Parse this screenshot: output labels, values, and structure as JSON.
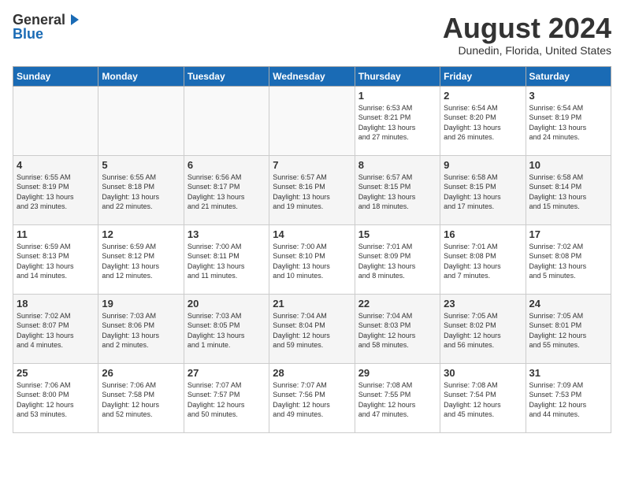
{
  "header": {
    "logo_general": "General",
    "logo_blue": "Blue",
    "title": "August 2024",
    "subtitle": "Dunedin, Florida, United States"
  },
  "weekdays": [
    "Sunday",
    "Monday",
    "Tuesday",
    "Wednesday",
    "Thursday",
    "Friday",
    "Saturday"
  ],
  "weeks": [
    [
      {
        "day": "",
        "info": ""
      },
      {
        "day": "",
        "info": ""
      },
      {
        "day": "",
        "info": ""
      },
      {
        "day": "",
        "info": ""
      },
      {
        "day": "1",
        "info": "Sunrise: 6:53 AM\nSunset: 8:21 PM\nDaylight: 13 hours\nand 27 minutes."
      },
      {
        "day": "2",
        "info": "Sunrise: 6:54 AM\nSunset: 8:20 PM\nDaylight: 13 hours\nand 26 minutes."
      },
      {
        "day": "3",
        "info": "Sunrise: 6:54 AM\nSunset: 8:19 PM\nDaylight: 13 hours\nand 24 minutes."
      }
    ],
    [
      {
        "day": "4",
        "info": "Sunrise: 6:55 AM\nSunset: 8:19 PM\nDaylight: 13 hours\nand 23 minutes."
      },
      {
        "day": "5",
        "info": "Sunrise: 6:55 AM\nSunset: 8:18 PM\nDaylight: 13 hours\nand 22 minutes."
      },
      {
        "day": "6",
        "info": "Sunrise: 6:56 AM\nSunset: 8:17 PM\nDaylight: 13 hours\nand 21 minutes."
      },
      {
        "day": "7",
        "info": "Sunrise: 6:57 AM\nSunset: 8:16 PM\nDaylight: 13 hours\nand 19 minutes."
      },
      {
        "day": "8",
        "info": "Sunrise: 6:57 AM\nSunset: 8:15 PM\nDaylight: 13 hours\nand 18 minutes."
      },
      {
        "day": "9",
        "info": "Sunrise: 6:58 AM\nSunset: 8:15 PM\nDaylight: 13 hours\nand 17 minutes."
      },
      {
        "day": "10",
        "info": "Sunrise: 6:58 AM\nSunset: 8:14 PM\nDaylight: 13 hours\nand 15 minutes."
      }
    ],
    [
      {
        "day": "11",
        "info": "Sunrise: 6:59 AM\nSunset: 8:13 PM\nDaylight: 13 hours\nand 14 minutes."
      },
      {
        "day": "12",
        "info": "Sunrise: 6:59 AM\nSunset: 8:12 PM\nDaylight: 13 hours\nand 12 minutes."
      },
      {
        "day": "13",
        "info": "Sunrise: 7:00 AM\nSunset: 8:11 PM\nDaylight: 13 hours\nand 11 minutes."
      },
      {
        "day": "14",
        "info": "Sunrise: 7:00 AM\nSunset: 8:10 PM\nDaylight: 13 hours\nand 10 minutes."
      },
      {
        "day": "15",
        "info": "Sunrise: 7:01 AM\nSunset: 8:09 PM\nDaylight: 13 hours\nand 8 minutes."
      },
      {
        "day": "16",
        "info": "Sunrise: 7:01 AM\nSunset: 8:08 PM\nDaylight: 13 hours\nand 7 minutes."
      },
      {
        "day": "17",
        "info": "Sunrise: 7:02 AM\nSunset: 8:08 PM\nDaylight: 13 hours\nand 5 minutes."
      }
    ],
    [
      {
        "day": "18",
        "info": "Sunrise: 7:02 AM\nSunset: 8:07 PM\nDaylight: 13 hours\nand 4 minutes."
      },
      {
        "day": "19",
        "info": "Sunrise: 7:03 AM\nSunset: 8:06 PM\nDaylight: 13 hours\nand 2 minutes."
      },
      {
        "day": "20",
        "info": "Sunrise: 7:03 AM\nSunset: 8:05 PM\nDaylight: 13 hours\nand 1 minute."
      },
      {
        "day": "21",
        "info": "Sunrise: 7:04 AM\nSunset: 8:04 PM\nDaylight: 12 hours\nand 59 minutes."
      },
      {
        "day": "22",
        "info": "Sunrise: 7:04 AM\nSunset: 8:03 PM\nDaylight: 12 hours\nand 58 minutes."
      },
      {
        "day": "23",
        "info": "Sunrise: 7:05 AM\nSunset: 8:02 PM\nDaylight: 12 hours\nand 56 minutes."
      },
      {
        "day": "24",
        "info": "Sunrise: 7:05 AM\nSunset: 8:01 PM\nDaylight: 12 hours\nand 55 minutes."
      }
    ],
    [
      {
        "day": "25",
        "info": "Sunrise: 7:06 AM\nSunset: 8:00 PM\nDaylight: 12 hours\nand 53 minutes."
      },
      {
        "day": "26",
        "info": "Sunrise: 7:06 AM\nSunset: 7:58 PM\nDaylight: 12 hours\nand 52 minutes."
      },
      {
        "day": "27",
        "info": "Sunrise: 7:07 AM\nSunset: 7:57 PM\nDaylight: 12 hours\nand 50 minutes."
      },
      {
        "day": "28",
        "info": "Sunrise: 7:07 AM\nSunset: 7:56 PM\nDaylight: 12 hours\nand 49 minutes."
      },
      {
        "day": "29",
        "info": "Sunrise: 7:08 AM\nSunset: 7:55 PM\nDaylight: 12 hours\nand 47 minutes."
      },
      {
        "day": "30",
        "info": "Sunrise: 7:08 AM\nSunset: 7:54 PM\nDaylight: 12 hours\nand 45 minutes."
      },
      {
        "day": "31",
        "info": "Sunrise: 7:09 AM\nSunset: 7:53 PM\nDaylight: 12 hours\nand 44 minutes."
      }
    ]
  ]
}
